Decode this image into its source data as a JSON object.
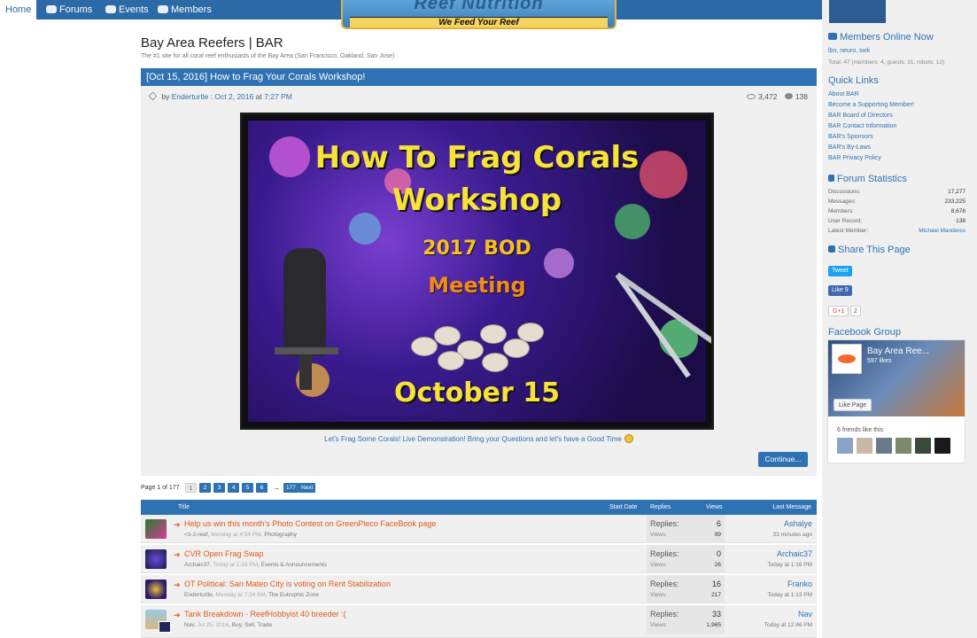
{
  "nav": {
    "home": "Home",
    "forums": "Forums",
    "events": "Events",
    "members": "Members"
  },
  "banner": {
    "brand": "Reef Nutrition",
    "tagline": "We Feed Your Reef"
  },
  "site": {
    "title": "Bay Area Reefers | BAR",
    "subtitle": "The #1 site for all coral reef enthusiasts of the Bay Area (San Francisco, Oakland, San Jose)"
  },
  "featured": {
    "title": "[Oct 15, 2016] How to Frag Your Corals Workshop!",
    "by": "by",
    "author": "Enderturtle",
    "date": "Oct 2, 2016",
    "at": "at",
    "time": "7:27 PM",
    "views": "3,472",
    "replies": "138",
    "image_text": {
      "line1": "How To Frag Corals",
      "line2": "Workshop",
      "line3": "2017 BOD",
      "line4": "Meeting",
      "line5": "October 15"
    },
    "caption": "Let's Frag Some Corals! Live Demonstration! Bring your Questions and let's have a Good Time",
    "continue": "Continue..."
  },
  "pager": {
    "label": "Page 1 of 177",
    "pages": [
      "1",
      "2",
      "3",
      "4",
      "5",
      "6"
    ],
    "arrow": "→",
    "last": "177",
    "next": "Next >"
  },
  "list": {
    "headers": {
      "title": "Title",
      "start_date": "Start Date",
      "replies": "Replies",
      "views": "Views",
      "last_message": "Last Message"
    },
    "rows": [
      {
        "title": "Help us win this month's Photo Contest on GreenPleco FaceBook page",
        "author": "<3-2-reef",
        "when": "Monday at 4:54 PM",
        "forum": "Photography",
        "replies_label": "Replies:",
        "replies": "6",
        "views_label": "Views:",
        "views": "99",
        "last_user": "Ashalye",
        "last_time": "33 minutes ago"
      },
      {
        "title": "CVR Open Frag Swap",
        "author": "Archaic37",
        "when": "Today at 1:16 PM",
        "forum": "Events & Announcements",
        "replies_label": "Replies:",
        "replies": "0",
        "views_label": "Views:",
        "views": "26",
        "last_user": "Archaic37",
        "last_time": "Today at 1:16 PM"
      },
      {
        "title": "OT Political: San Mateo City is voting on Rent Stabilization",
        "author": "Enderturtle",
        "when": "Monday at 7:24 AM",
        "forum": "The Eutrophic Zone",
        "replies_label": "Replies:",
        "replies": "16",
        "views_label": "Views:",
        "views": "217",
        "last_user": "Franko",
        "last_time": "Today at 1:13 PM"
      },
      {
        "title": "Tank Breakdown - ReefHobbyist 40 breeder :(",
        "author": "Nav",
        "when": "Jul 25, 2016",
        "forum": "Buy, Sell, Trade",
        "replies_label": "Replies:",
        "replies": "33",
        "views_label": "Views:",
        "views": "1,965",
        "last_user": "Nav",
        "last_time": "Today at 12:46 PM"
      }
    ]
  },
  "sidebar": {
    "members_online": {
      "heading": "Members Online Now",
      "names": "lbn, neuro, swk",
      "total": "Total: 47 (members: 4, guests: 31, robots: 12)"
    },
    "quick_links": {
      "heading": "Quick Links",
      "items": [
        "About BAR",
        "Become a Supporting Member!",
        "BAR Board of Directors",
        "BAR Contact Information",
        "BAR's Sponsors",
        "BAR's By-Laws",
        "BAR Privacy Policy"
      ]
    },
    "forum_stats": {
      "heading": "Forum Statistics",
      "rows": [
        {
          "label": "Discussions:",
          "value": "17,277"
        },
        {
          "label": "Messages:",
          "value": "233,225"
        },
        {
          "label": "Members:",
          "value": "8,678"
        },
        {
          "label": "User Record:",
          "value": "138"
        },
        {
          "label": "Latest Member:",
          "value": "Michael Manderss"
        }
      ]
    },
    "share": {
      "heading": "Share This Page",
      "tweet": "Tweet",
      "like": "Like 9",
      "gplus": "G+1",
      "gplus_count": "2"
    },
    "facebook": {
      "heading": "Facebook Group",
      "page_name": "Bay Area Ree...",
      "likes": "597 likes",
      "like_page": "Like Page",
      "friends": "6 friends like this"
    }
  }
}
